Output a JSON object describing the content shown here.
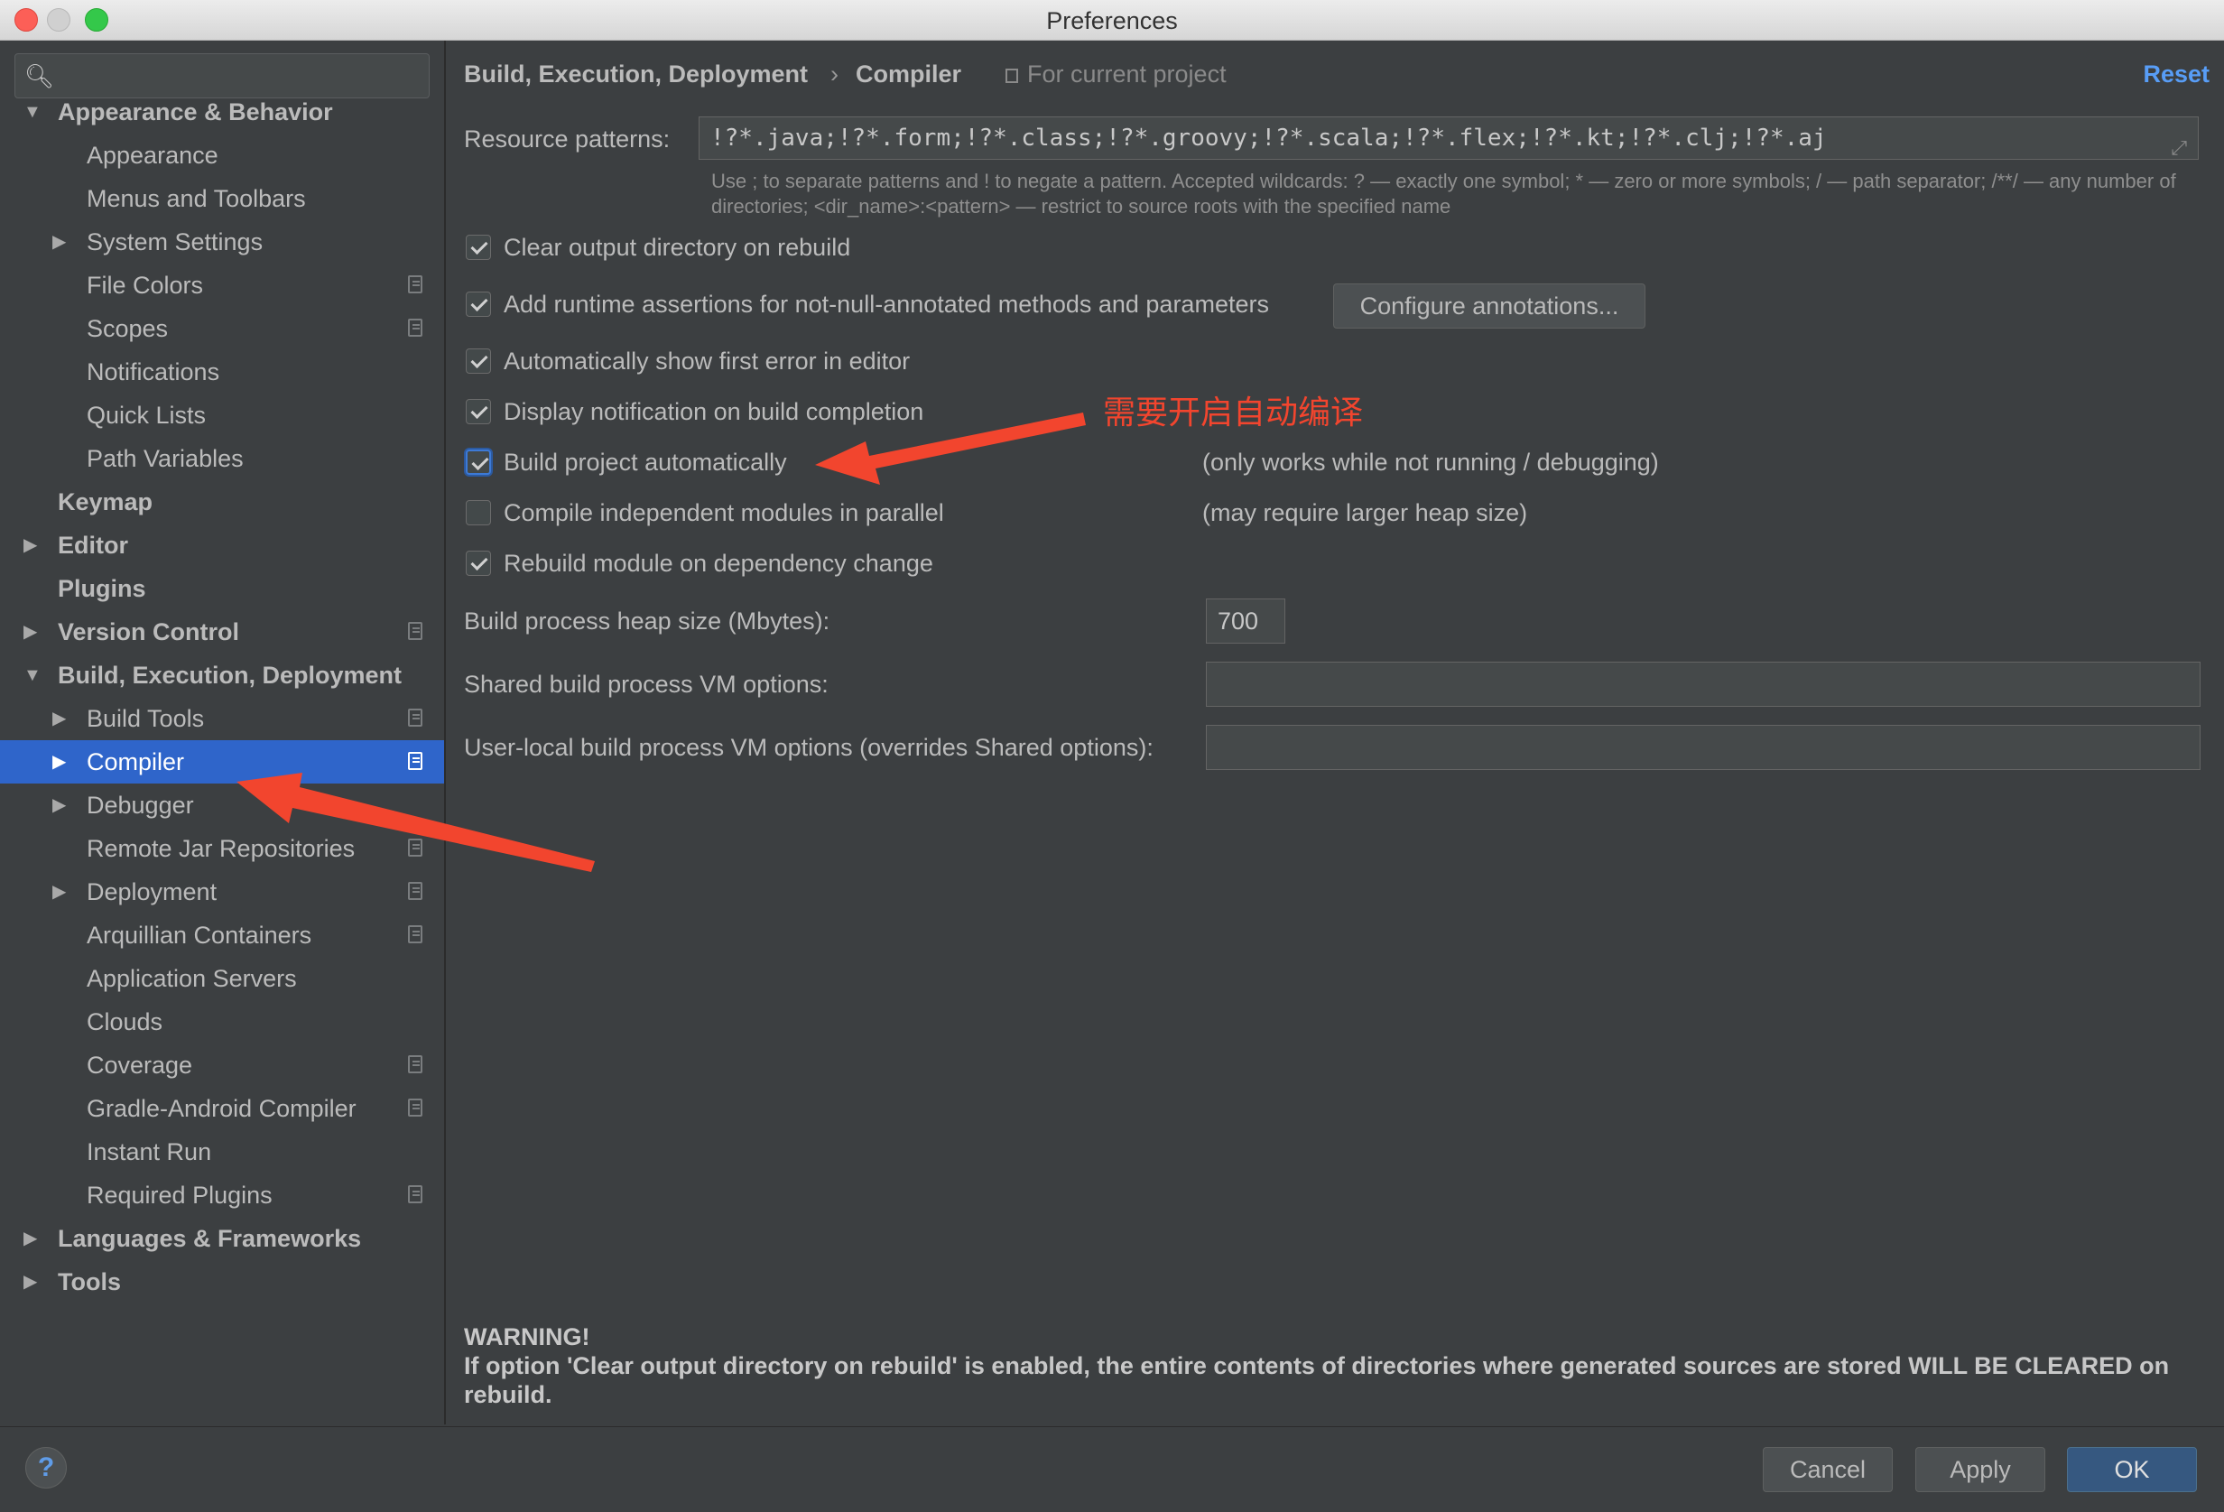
{
  "window": {
    "title": "Preferences"
  },
  "sidebar": {
    "search_placeholder": "",
    "items": [
      {
        "label": "Appearance & Behavior",
        "level": 0,
        "arrow": "▼",
        "bold": true,
        "project_icon": false
      },
      {
        "label": "Appearance",
        "level": 1,
        "arrow": "",
        "bold": false,
        "project_icon": false
      },
      {
        "label": "Menus and Toolbars",
        "level": 1,
        "arrow": "",
        "bold": false,
        "project_icon": false
      },
      {
        "label": "System Settings",
        "level": 1,
        "arrow": "▶",
        "bold": false,
        "project_icon": false
      },
      {
        "label": "File Colors",
        "level": 1,
        "arrow": "",
        "bold": false,
        "project_icon": true
      },
      {
        "label": "Scopes",
        "level": 1,
        "arrow": "",
        "bold": false,
        "project_icon": true
      },
      {
        "label": "Notifications",
        "level": 1,
        "arrow": "",
        "bold": false,
        "project_icon": false
      },
      {
        "label": "Quick Lists",
        "level": 1,
        "arrow": "",
        "bold": false,
        "project_icon": false
      },
      {
        "label": "Path Variables",
        "level": 1,
        "arrow": "",
        "bold": false,
        "project_icon": false
      },
      {
        "label": "Keymap",
        "level": 0,
        "arrow": "",
        "bold": true,
        "project_icon": false
      },
      {
        "label": "Editor",
        "level": 0,
        "arrow": "▶",
        "bold": true,
        "project_icon": false
      },
      {
        "label": "Plugins",
        "level": 0,
        "arrow": "",
        "bold": true,
        "project_icon": false
      },
      {
        "label": "Version Control",
        "level": 0,
        "arrow": "▶",
        "bold": true,
        "project_icon": true
      },
      {
        "label": "Build, Execution, Deployment",
        "level": 0,
        "arrow": "▼",
        "bold": true,
        "project_icon": false
      },
      {
        "label": "Build Tools",
        "level": 1,
        "arrow": "▶",
        "bold": false,
        "project_icon": true
      },
      {
        "label": "Compiler",
        "level": 1,
        "arrow": "▶",
        "bold": false,
        "project_icon": true,
        "selected": true
      },
      {
        "label": "Debugger",
        "level": 1,
        "arrow": "▶",
        "bold": false,
        "project_icon": false
      },
      {
        "label": "Remote Jar Repositories",
        "level": 1,
        "arrow": "",
        "bold": false,
        "project_icon": true
      },
      {
        "label": "Deployment",
        "level": 1,
        "arrow": "▶",
        "bold": false,
        "project_icon": true
      },
      {
        "label": "Arquillian Containers",
        "level": 1,
        "arrow": "",
        "bold": false,
        "project_icon": true
      },
      {
        "label": "Application Servers",
        "level": 1,
        "arrow": "",
        "bold": false,
        "project_icon": false
      },
      {
        "label": "Clouds",
        "level": 1,
        "arrow": "",
        "bold": false,
        "project_icon": false
      },
      {
        "label": "Coverage",
        "level": 1,
        "arrow": "",
        "bold": false,
        "project_icon": true
      },
      {
        "label": "Gradle-Android Compiler",
        "level": 1,
        "arrow": "",
        "bold": false,
        "project_icon": true
      },
      {
        "label": "Instant Run",
        "level": 1,
        "arrow": "",
        "bold": false,
        "project_icon": false
      },
      {
        "label": "Required Plugins",
        "level": 1,
        "arrow": "",
        "bold": false,
        "project_icon": true
      },
      {
        "label": "Languages & Frameworks",
        "level": 0,
        "arrow": "▶",
        "bold": true,
        "project_icon": false
      },
      {
        "label": "Tools",
        "level": 0,
        "arrow": "▶",
        "bold": true,
        "project_icon": false
      }
    ]
  },
  "header": {
    "breadcrumb_parent": "Build, Execution, Deployment",
    "breadcrumb_sep": "›",
    "breadcrumb_current": "Compiler",
    "scope_label": "For current project",
    "reset_label": "Reset"
  },
  "compiler": {
    "resource_patterns_label": "Resource patterns:",
    "resource_patterns_value": "!?*.java;!?*.form;!?*.class;!?*.groovy;!?*.scala;!?*.flex;!?*.kt;!?*.clj;!?*.aj",
    "resource_patterns_hint": "Use ; to separate patterns and ! to negate a pattern. Accepted wildcards: ? — exactly one symbol; * — zero or more symbols; / — path separator; /**/ — any number of directories; <dir_name>:<pattern> — restrict to source roots with the specified name",
    "clear_output": {
      "label": "Clear output directory on rebuild",
      "checked": true
    },
    "runtime_assertions": {
      "label": "Add runtime assertions for not-null-annotated methods and parameters",
      "checked": true
    },
    "configure_annotations_label": "Configure annotations...",
    "show_first_error": {
      "label": "Automatically show first error in editor",
      "checked": true
    },
    "display_notification": {
      "label": "Display notification on build completion",
      "checked": true
    },
    "build_automatically": {
      "label": "Build project automatically",
      "checked": true,
      "note": "(only works while not running / debugging)"
    },
    "compile_parallel": {
      "label": "Compile independent modules in parallel",
      "checked": false,
      "note": "(may require larger heap size)"
    },
    "rebuild_on_dependency": {
      "label": "Rebuild module on dependency change",
      "checked": true
    },
    "heap_size_label": "Build process heap size (Mbytes):",
    "heap_size_value": "700",
    "shared_vm_label": "Shared build process VM options:",
    "shared_vm_value": "",
    "user_vm_label": "User-local build process VM options (overrides Shared options):",
    "user_vm_value": "",
    "warning_title": "WARNING!",
    "warning_text": "If option 'Clear output directory on rebuild' is enabled, the entire contents of directories where generated sources are stored WILL BE CLEARED on rebuild."
  },
  "annotation": {
    "text": "需要开启自动编译",
    "color": "#f2452e"
  },
  "footer": {
    "help_label": "?",
    "cancel_label": "Cancel",
    "apply_label": "Apply",
    "ok_label": "OK"
  },
  "colors": {
    "background": "#3c3f41",
    "selection": "#2f65ca",
    "link": "#589df6",
    "default_button": "#365880"
  }
}
